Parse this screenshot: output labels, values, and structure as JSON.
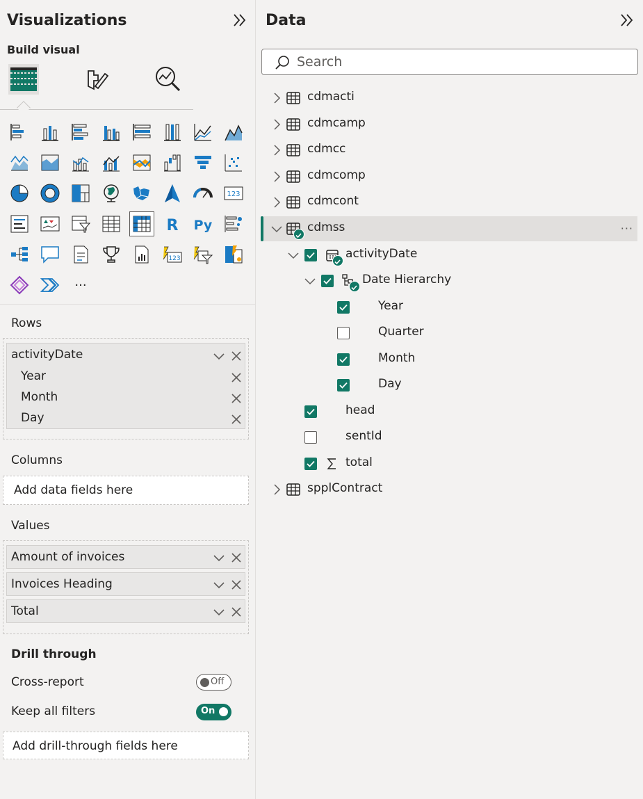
{
  "visualizations": {
    "title": "Visualizations",
    "build_visual_label": "Build visual",
    "more_visuals": "···",
    "rows": {
      "label": "Rows",
      "field": "activityDate",
      "sub_fields": [
        "Year",
        "Month",
        "Day"
      ]
    },
    "columns": {
      "label": "Columns",
      "placeholder": "Add data fields here"
    },
    "values": {
      "label": "Values",
      "fields": [
        "Amount of invoices",
        "Invoices Heading",
        "Total"
      ]
    },
    "drill_through": {
      "title": "Drill through",
      "cross_report_label": "Cross-report",
      "cross_report_state": "Off",
      "keep_filters_label": "Keep all filters",
      "keep_filters_state": "On",
      "placeholder": "Add drill-through fields here"
    }
  },
  "data": {
    "title": "Data",
    "search_placeholder": "Search",
    "tables": {
      "t1": "cdmacti",
      "t2": "cdmcamp",
      "t3": "cdmcc",
      "t4": "cdmcomp",
      "t5": "cdmcont",
      "t6": "cdmss",
      "t7": "spplContract"
    },
    "fields": {
      "activity_date": "activityDate",
      "date_hierarchy": "Date Hierarchy",
      "year": "Year",
      "quarter": "Quarter",
      "month": "Month",
      "day": "Day",
      "head": "head",
      "sent_id": "sentId",
      "total": "total"
    },
    "more": "···"
  },
  "colors": {
    "accent": "#117865",
    "blue": "#1b7bc4",
    "yellow": "#f2c811"
  }
}
